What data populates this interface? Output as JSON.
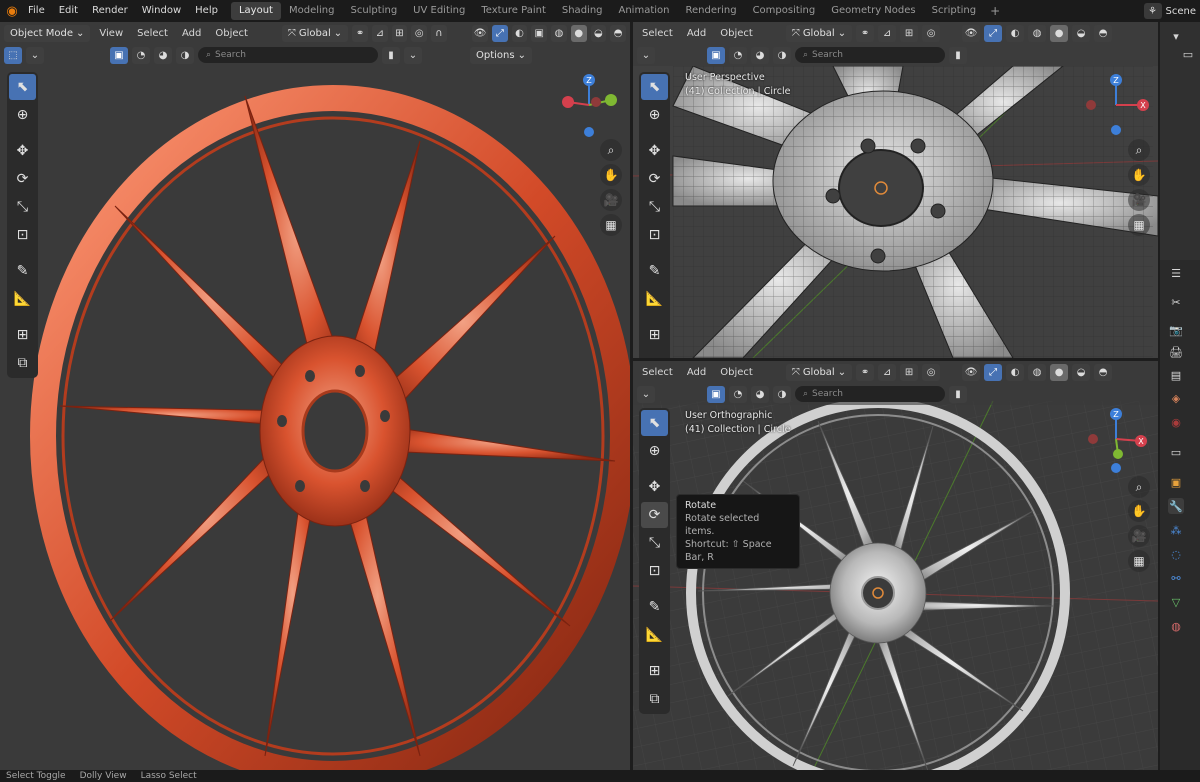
{
  "topbar": {
    "menus": [
      "File",
      "Edit",
      "Render",
      "Window",
      "Help"
    ],
    "workspaces": [
      "Layout",
      "Modeling",
      "Sculpting",
      "UV Editing",
      "Texture Paint",
      "Shading",
      "Animation",
      "Rendering",
      "Compositing",
      "Geometry Nodes",
      "Scripting"
    ],
    "active_workspace": "Layout",
    "add_workspace": "+",
    "scene_label": "Scene"
  },
  "left_viewport": {
    "mode": "Object Mode",
    "menus": [
      "View",
      "Select",
      "Add",
      "Object"
    ],
    "transform_orientation": "Global",
    "search_placeholder": "Search",
    "options_label": "Options"
  },
  "top_right_viewport": {
    "menus": [
      "Select",
      "Add",
      "Object"
    ],
    "transform_orientation": "Global",
    "search_placeholder": "Search",
    "view_name": "User Perspective",
    "collection_text": "(41) Collection | Circle"
  },
  "bottom_right_viewport": {
    "menus": [
      "Select",
      "Add",
      "Object"
    ],
    "transform_orientation": "Global",
    "search_placeholder": "Search",
    "view_name": "User Orthographic",
    "collection_text": "(41) Collection | Circle"
  },
  "tooltip": {
    "title": "Rotate",
    "description": "Rotate selected items.",
    "shortcut": "Shortcut: ⇧ Space Bar, R"
  },
  "gizmo": {
    "x": "X",
    "y": "Y",
    "z": "Z"
  },
  "statusbar": {
    "items": [
      "Select Toggle",
      "Dolly View",
      "Lasso Select"
    ]
  },
  "colors": {
    "accent": "#4772b3",
    "wheel_main": "#d9532f",
    "blender_orange": "#e87d0d",
    "axis_x": "#d4404d",
    "axis_y": "#7fb832",
    "axis_z": "#3d7fd9"
  }
}
